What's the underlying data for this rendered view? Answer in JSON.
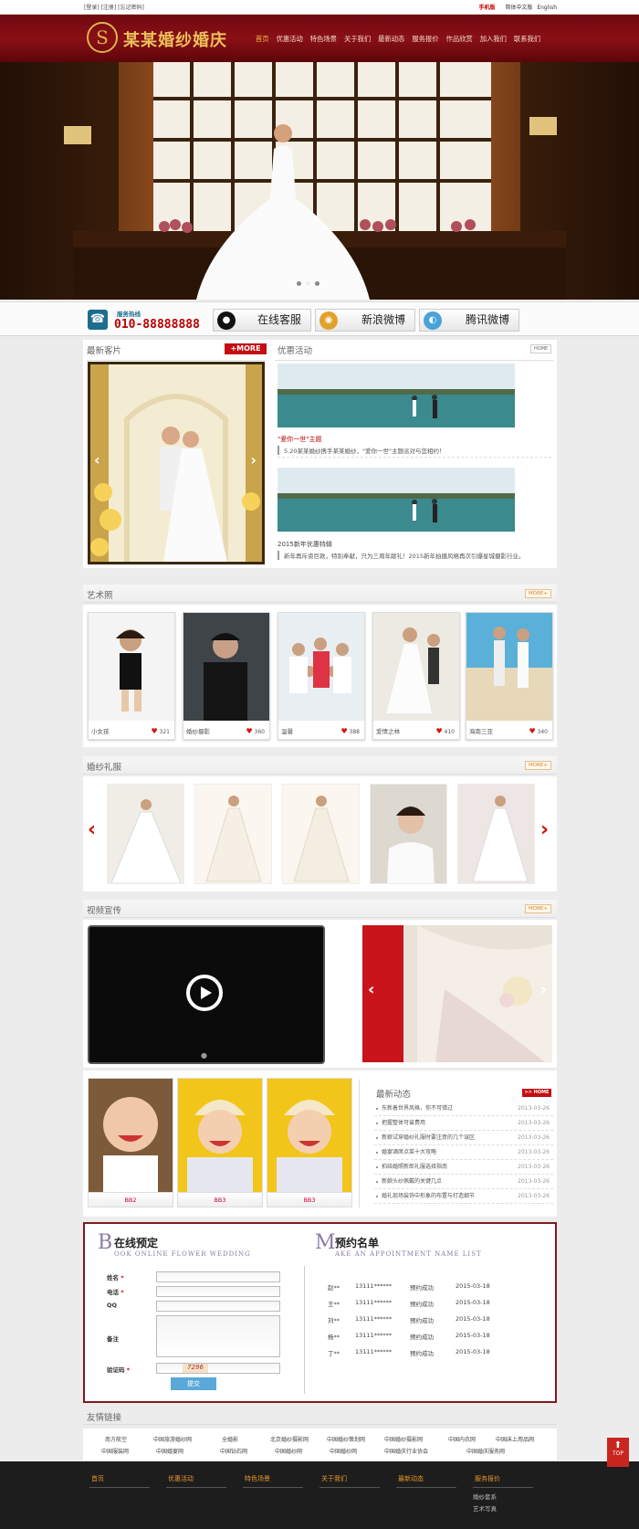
{
  "topbar": {
    "user_links": "[登录] [注册] [忘记密码]",
    "mobile": "手机版",
    "lang_cn": "简体中文版",
    "lang_en": "English"
  },
  "header": {
    "logo_text": "某某婚纱婚庆",
    "nav": [
      "首页",
      "优惠活动",
      "特色场景",
      "关于我们",
      "最新动态",
      "服务报价",
      "作品欣赏",
      "加入我们",
      "联系我们"
    ]
  },
  "contact": {
    "hotline_label": "服务热线",
    "hotline": "010-88888888",
    "online_service": "在线客服",
    "sina_weibo": "新浪微博",
    "tencent_weibo": "腾讯微博"
  },
  "guests": {
    "title": "最新客片",
    "more": "+MORE"
  },
  "offers": {
    "title": "优惠活动",
    "home": "HOME",
    "items": [
      {
        "title": "\"爱你一世\"主题",
        "desc": "5.20某某婚纱携手某某婚纱，\"爱你一世\"主题派对与您相约！"
      },
      {
        "title": "2015新年优惠特辑",
        "desc": "新年再斥资巨款，特别奉献，只为三周年献礼！2015新年拍摄风格再次引爆星城摄影行业。"
      }
    ]
  },
  "art": {
    "title": "艺术照",
    "more": "MORE+",
    "items": [
      {
        "name": "小女孩",
        "likes": "321"
      },
      {
        "name": "婚纱摄影",
        "likes": "360"
      },
      {
        "name": "温馨",
        "likes": "388"
      },
      {
        "name": "爱情之林",
        "likes": "410"
      },
      {
        "name": "海南三亚",
        "likes": "340"
      }
    ]
  },
  "dress": {
    "title": "婚纱礼服",
    "more": "MORE+"
  },
  "video": {
    "title": "视频宣传",
    "more": "MORE+"
  },
  "babies": [
    "BB2",
    "BB3",
    "BB3"
  ],
  "news": {
    "title": "最新动态",
    "home": ">> HOME",
    "items": [
      {
        "t": "东新着世界风格，你不可错过",
        "d": "2013-03-26"
      },
      {
        "t": "把握整体可省费用",
        "d": "2013-03-26"
      },
      {
        "t": "新娘试穿婚纱礼服时要注意的几个误区",
        "d": "2013-03-26"
      },
      {
        "t": "婚宴酒席点菜十大攻略",
        "d": "2013-03-26"
      },
      {
        "t": "拍结婚照新郎礼服选择指南",
        "d": "2013-03-26"
      },
      {
        "t": "新娘头纱佩戴的关键几点",
        "d": "2013-03-26"
      },
      {
        "t": "婚礼现场装饰中形象的布置与打造细节",
        "d": "2013-03-26"
      }
    ]
  },
  "booking": {
    "letter": "B",
    "title": "在线预定",
    "sub": "OOK ONLINE FLOWER WEDDING",
    "fields": [
      "姓名",
      "电话",
      "QQ",
      "备注",
      "验证码"
    ],
    "submit": "提交",
    "captcha": "7296"
  },
  "appointments": {
    "letter": "M",
    "title": "预约名单",
    "sub": "AKE AN APPOINTMENT NAME LIST",
    "rows": [
      {
        "n": "赵**",
        "p": "13111******",
        "s": "预约成功",
        "d": "2015-03-18"
      },
      {
        "n": "王**",
        "p": "13111******",
        "s": "预约成功",
        "d": "2015-03-18"
      },
      {
        "n": "刘**",
        "p": "13111******",
        "s": "预约成功",
        "d": "2015-03-18"
      },
      {
        "n": "杨**",
        "p": "13111******",
        "s": "预约成功",
        "d": "2015-03-18"
      },
      {
        "n": "丁**",
        "p": "13111******",
        "s": "预约成功",
        "d": "2015-03-18"
      }
    ]
  },
  "links": {
    "title": "友情链接",
    "row1": [
      "南方航空",
      "中国旅游婚纱网",
      "全婚影",
      "北京婚纱摄影网",
      "中国婚纱策划网",
      "中国婚纱摄影网",
      "中国内衣网",
      "中国床上用品网"
    ],
    "row2": [
      "中国服装网",
      "中国婚宴网",
      "中国钻石网",
      "中国婚纱网",
      "中国婚纱网",
      "中国婚庆行业协会",
      "中国婚庆服务网"
    ]
  },
  "footer": {
    "cols": [
      "首页",
      "优惠活动",
      "特色场景",
      "关于我们",
      "最新动态",
      "服务报价"
    ],
    "subs": [
      "婚纱套系",
      "艺术写真"
    ]
  },
  "top_btn": "TOP",
  "colors": {
    "brand_red": "#8a1015",
    "accent_gold": "#ecc05a",
    "like_red": "#d11111"
  }
}
